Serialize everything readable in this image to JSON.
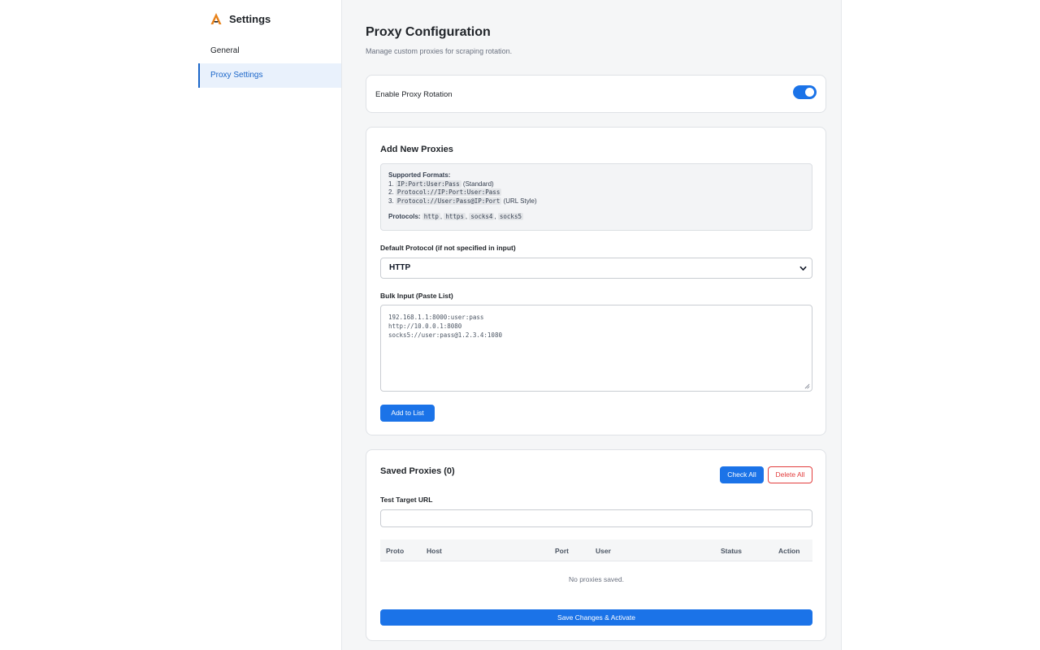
{
  "sidebar": {
    "title": "Settings",
    "items": [
      {
        "label": "General",
        "active": false
      },
      {
        "label": "Proxy Settings",
        "active": true
      }
    ]
  },
  "page": {
    "title": "Proxy Configuration",
    "subtitle": "Manage custom proxies for scraping rotation."
  },
  "rotation": {
    "label": "Enable Proxy Rotation",
    "enabled": true
  },
  "add": {
    "heading": "Add New Proxies",
    "formats_title": "Supported Formats:",
    "formats": [
      {
        "num": "1.",
        "code": "IP:Port:User:Pass",
        "note": "(Standard)"
      },
      {
        "num": "2.",
        "code": "Protocol://IP:Port:User:Pass",
        "note": ""
      },
      {
        "num": "3.",
        "code": "Protocol://User:Pass@IP:Port",
        "note": "(URL Style)"
      }
    ],
    "protocols_label": "Protocols:",
    "protocols": [
      "http",
      "https",
      "socks4",
      "socks5"
    ],
    "protocol_field_label": "Default Protocol (if not specified in input)",
    "protocol_value": "HTTP",
    "bulk_label": "Bulk Input (Paste List)",
    "bulk_lines": [
      "192.168.1.1:8000:user:pass",
      "http://10.0.0.1:8080",
      "socks5://user:pass@1.2.3.4:1080"
    ],
    "add_button": "Add to List"
  },
  "saved": {
    "heading": "Saved Proxies (0)",
    "check_all": "Check All",
    "delete_all": "Delete All",
    "test_url_label": "Test Target URL",
    "test_url_value": "",
    "columns": [
      "Proto",
      "Host",
      "Port",
      "User",
      "Status",
      "Action"
    ],
    "empty_message": "No proxies saved.",
    "save_button": "Save Changes & Activate"
  },
  "colors": {
    "accent": "#1b73e8",
    "active_nav_bg": "#e9f1fc",
    "danger": "#e23d3d",
    "logo": "#e8821a"
  }
}
